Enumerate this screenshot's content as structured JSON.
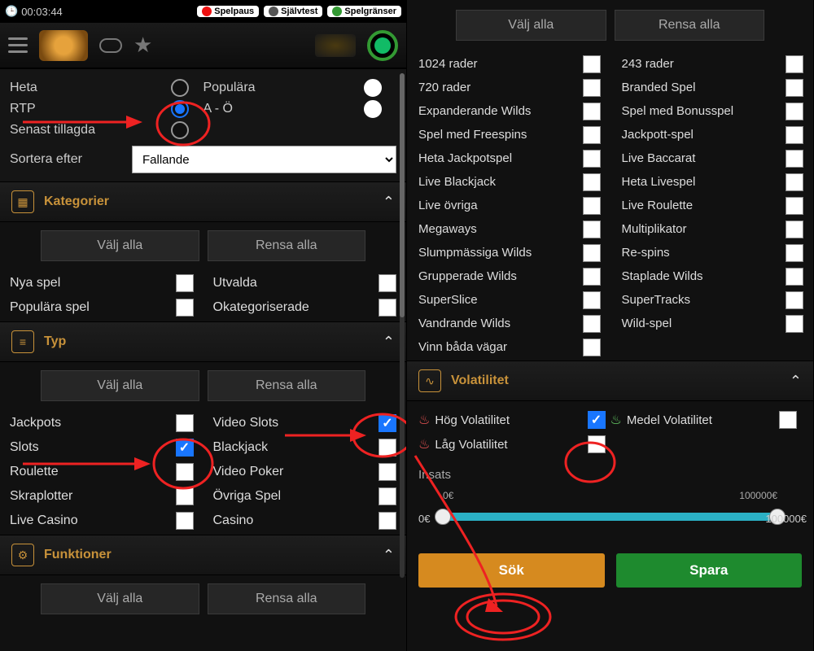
{
  "topbar": {
    "time": "00:03:44",
    "spelpaus": "Spelpaus",
    "sjalvtest": "Självtest",
    "spelgranser": "Spelgränser"
  },
  "sort": {
    "heta": "Heta",
    "populara": "Populära",
    "rtp": "RTP",
    "aoe": "A - Ö",
    "senast": "Senast tillagda",
    "sortera_efter": "Sortera efter",
    "fallande": "Fallande"
  },
  "buttons": {
    "valj_alla": "Välj alla",
    "rensa_alla": "Rensa alla"
  },
  "acc": {
    "kategorier": "Kategorier",
    "typ": "Typ",
    "funktioner": "Funktioner",
    "volatilitet": "Volatilitet"
  },
  "kategorier": {
    "nya_spel": "Nya spel",
    "utvalda": "Utvalda",
    "populara_spel": "Populära spel",
    "okategoriserade": "Okategoriserade"
  },
  "typ": {
    "jackpots": "Jackpots",
    "video_slots": "Video Slots",
    "slots": "Slots",
    "blackjack": "Blackjack",
    "roulette": "Roulette",
    "video_poker": "Video Poker",
    "skraplotter": "Skraplotter",
    "ovriga_spel": "Övriga Spel",
    "live_casino": "Live Casino",
    "casino": "Casino"
  },
  "rightcats": {
    "r1024": "1024 rader",
    "r243": "243 rader",
    "r720": "720 rader",
    "branded": "Branded Spel",
    "exp_wilds": "Expanderande Wilds",
    "bonusspel": "Spel med Bonusspel",
    "freespins": "Spel med Freespins",
    "jackpott": "Jackpott-spel",
    "heta_jackpot": "Heta Jackpotspel",
    "live_baccarat": "Live Baccarat",
    "live_blackjack": "Live Blackjack",
    "heta_livespel": "Heta Livespel",
    "live_ovriga": "Live övriga",
    "live_roulette": "Live Roulette",
    "megaways": "Megaways",
    "multiplikator": "Multiplikator",
    "slump_wilds": "Slumpmässiga Wilds",
    "respins": "Re-spins",
    "grupp_wilds": "Grupperade Wilds",
    "stapl_wilds": "Staplade Wilds",
    "superslice": "SuperSlice",
    "supertracks": "SuperTracks",
    "vandrande": "Vandrande Wilds",
    "wildspel": "Wild-spel",
    "vinn_bada": "Vinn båda vägar"
  },
  "volat": {
    "hog": "Hög Volatilitet",
    "medel": "Medel Volatilitet",
    "lag": "Låg Volatilitet",
    "insats": "Insats",
    "min": "0€",
    "max": "100000€"
  },
  "actions": {
    "sok": "Sök",
    "spara": "Spara"
  }
}
